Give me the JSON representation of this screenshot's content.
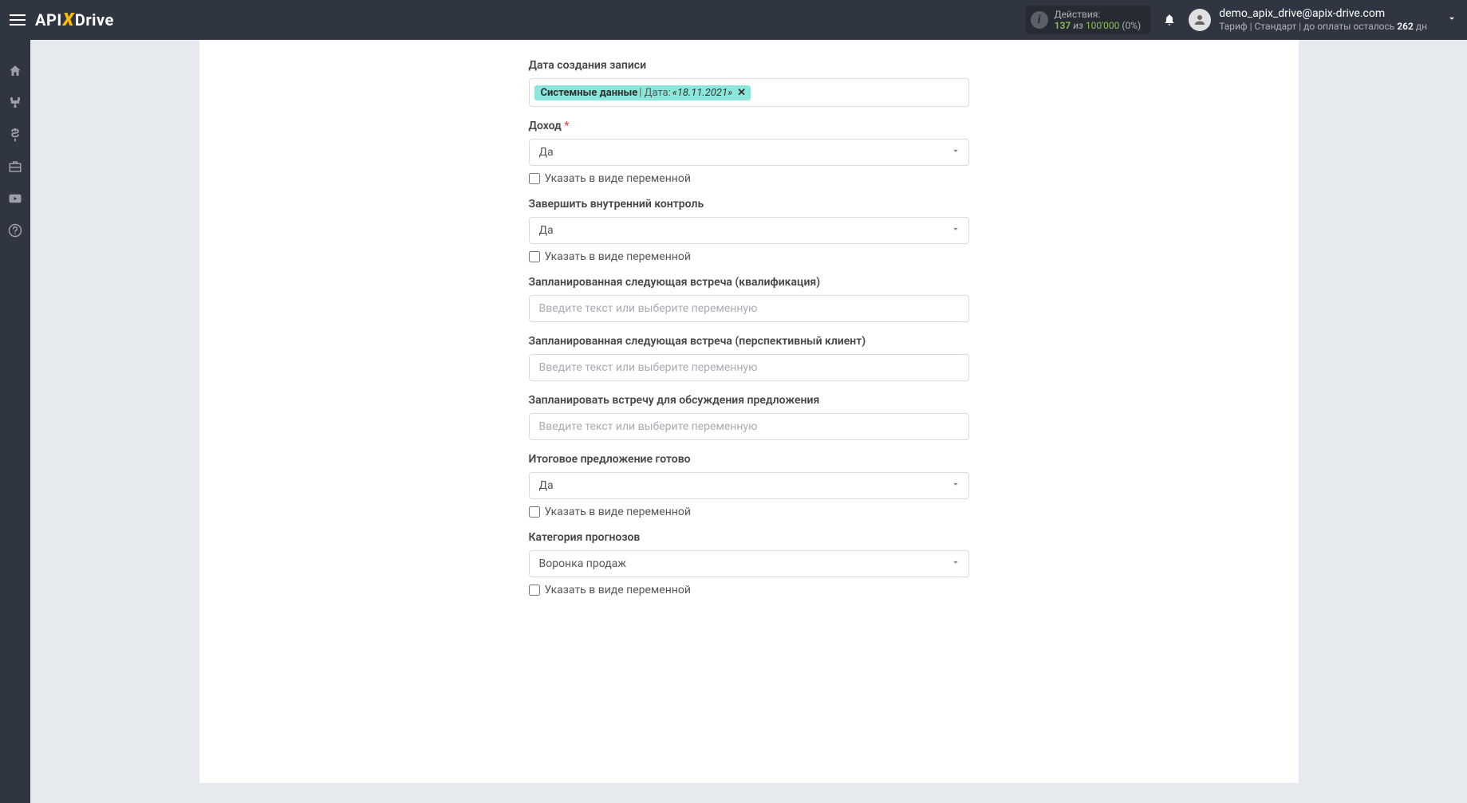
{
  "header": {
    "logo": {
      "part1": "API",
      "part2": "X",
      "part3": "Drive"
    },
    "actions": {
      "label": "Действия:",
      "used": "137",
      "of_label": "из",
      "limit": "100'000",
      "percent": "(0%)"
    },
    "user": {
      "email": "demo_apix_drive@apix-drive.com",
      "tariff_prefix": "Тариф | Стандарт | до оплаты осталось ",
      "days": "262",
      "days_suffix": " дн"
    }
  },
  "form": {
    "created_at": {
      "label": "Дата создания записи",
      "tag_prefix": "Системные данные",
      "tag_sep": " | Дата: ",
      "tag_value": "«18.11.2021»"
    },
    "income": {
      "label": "Доход",
      "required": "*",
      "value": "Да",
      "checkbox": "Указать в виде переменной"
    },
    "internal_control": {
      "label": "Завершить внутренний контроль",
      "value": "Да",
      "checkbox": "Указать в виде переменной"
    },
    "meeting_qualification": {
      "label": "Запланированная следующая встреча (квалификация)",
      "placeholder": "Введите текст или выберите переменную"
    },
    "meeting_prospect": {
      "label": "Запланированная следующая встреча (перспективный клиент)",
      "placeholder": "Введите текст или выберите переменную"
    },
    "meeting_proposal": {
      "label": "Запланировать встречу для обсуждения предложения",
      "placeholder": "Введите текст или выберите переменную"
    },
    "final_proposal_ready": {
      "label": "Итоговое предложение готово",
      "value": "Да",
      "checkbox": "Указать в виде переменной"
    },
    "forecast_category": {
      "label": "Категория прогнозов",
      "value": "Воронка продаж",
      "checkbox": "Указать в виде переменной"
    }
  }
}
